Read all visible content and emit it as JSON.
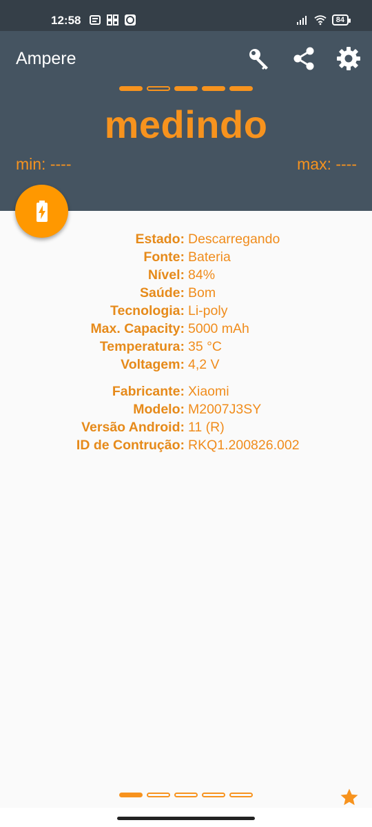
{
  "status_bar": {
    "time": "12:58",
    "battery_level": "84",
    "icons_left": [
      "message-icon",
      "apps-grid-icon",
      "android-icon"
    ],
    "icons_right": [
      "signal-icon",
      "wifi-icon",
      "battery-icon"
    ]
  },
  "app_bar": {
    "title": "Ampere",
    "actions": [
      "key-icon",
      "share-icon",
      "settings-icon"
    ]
  },
  "measurement": {
    "status": "medindo",
    "min_label": "min: ----",
    "max_label": "max: ----",
    "page_indicator": {
      "count": 5,
      "active_index": 1
    }
  },
  "fab": {
    "icon": "battery-charging-icon"
  },
  "battery_info": [
    {
      "label": "Estado:",
      "value": "Descarregando"
    },
    {
      "label": "Fonte:",
      "value": "Bateria"
    },
    {
      "label": "Nível:",
      "value": "84%"
    },
    {
      "label": "Saúde:",
      "value": "Bom"
    },
    {
      "label": "Tecnologia:",
      "value": "Li-poly"
    },
    {
      "label": "Max. Capacity:",
      "value": "5000 mAh"
    },
    {
      "label": "Temperatura:",
      "value": "35 °C"
    },
    {
      "label": "Voltagem:",
      "value": "4,2 V"
    }
  ],
  "device_info": [
    {
      "label": "Fabricante:",
      "value": "Xiaomi"
    },
    {
      "label": "Modelo:",
      "value": "M2007J3SY"
    },
    {
      "label": "Versão Android:",
      "value": "11 (R)"
    },
    {
      "label": "ID de Contrução:",
      "value": "RKQ1.200826.002"
    }
  ],
  "bottom": {
    "page_indicator": {
      "count": 5,
      "active_index": 0
    },
    "star_icon": "star-icon"
  },
  "colors": {
    "accent": "#f7931e",
    "header_bg": "#455461",
    "status_bg": "#353f48",
    "background": "#fafafa"
  }
}
